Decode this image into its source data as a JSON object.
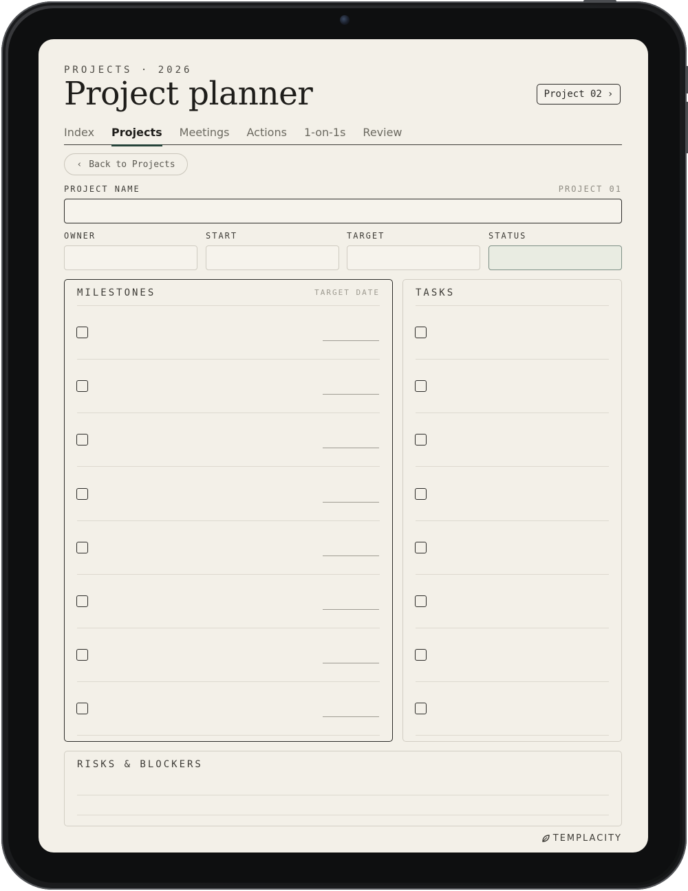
{
  "header": {
    "eyebrow": "PROJECTS · 2026",
    "title": "Project planner",
    "next_project": {
      "label": "Project 02",
      "chevron": "›"
    }
  },
  "tabs": [
    {
      "label": "Index",
      "active": false
    },
    {
      "label": "Projects",
      "active": true
    },
    {
      "label": "Meetings",
      "active": false
    },
    {
      "label": "Actions",
      "active": false
    },
    {
      "label": "1-on-1s",
      "active": false
    },
    {
      "label": "Review",
      "active": false
    }
  ],
  "back": {
    "chevron": "‹",
    "label": "Back to Projects"
  },
  "project_name": {
    "label": "PROJECT NAME",
    "project_number": "PROJECT 01",
    "value": ""
  },
  "meta_fields": [
    {
      "label": "OWNER",
      "value": ""
    },
    {
      "label": "START",
      "value": ""
    },
    {
      "label": "TARGET",
      "value": ""
    },
    {
      "label": "STATUS",
      "value": ""
    }
  ],
  "milestones": {
    "title": "MILESTONES",
    "date_header": "TARGET DATE",
    "row_count": 8
  },
  "tasks": {
    "title": "TASKS",
    "row_count": 8
  },
  "risks": {
    "title": "RISKS & BLOCKERS"
  },
  "footer": {
    "brand": "TEMPLACITY",
    "brand_icon": "leaf-logo-icon"
  },
  "colors": {
    "paper": "#f3f0e8",
    "ink": "#1e1d1a",
    "accent": "#26443a",
    "status_fill": "#e9ece2"
  }
}
